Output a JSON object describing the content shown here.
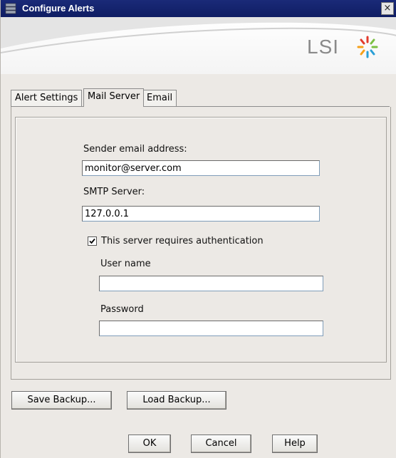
{
  "window": {
    "title": "Configure Alerts",
    "close_glyph": "×"
  },
  "branding": {
    "logo_text": "LSI",
    "logo_icon": "lsi-starburst-icon"
  },
  "tabs": [
    {
      "label": "Alert Settings",
      "active": false
    },
    {
      "label": "Mail Server",
      "active": true
    },
    {
      "label": "Email",
      "active": false
    }
  ],
  "mail_server": {
    "sender_label": "Sender email address:",
    "sender_value": "monitor@server.com",
    "smtp_label": "SMTP Server:",
    "smtp_value": "127.0.0.1",
    "auth_label": "This server requires authentication",
    "auth_checked": true,
    "username_label": "User name",
    "username_value": "",
    "password_label": "Password",
    "password_value": ""
  },
  "buttons": {
    "save_backup": "Save Backup...",
    "load_backup": "Load Backup...",
    "ok": "OK",
    "cancel": "Cancel",
    "help": "Help"
  },
  "colors": {
    "titlebar": "#0f1d63",
    "dialog_bg": "#ece9e5",
    "field_border": "#7f9db9"
  }
}
